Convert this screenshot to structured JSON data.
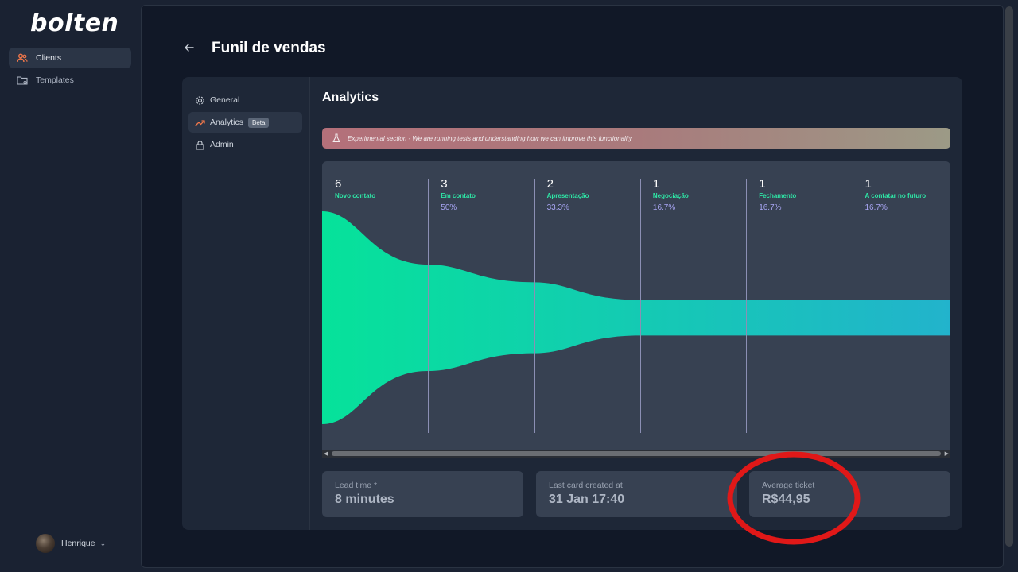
{
  "app": {
    "logo": "bolten"
  },
  "sidebar": {
    "items": [
      {
        "label": "Clients",
        "icon": "users-icon",
        "active": true
      },
      {
        "label": "Templates",
        "icon": "folder-settings-icon",
        "active": false
      }
    ]
  },
  "user": {
    "name": "Henrique"
  },
  "header": {
    "title": "Funil de vendas"
  },
  "settings_nav": {
    "items": [
      {
        "label": "General",
        "icon": "gear-icon"
      },
      {
        "label": "Analytics",
        "icon": "trending-up-icon",
        "badge": "Beta",
        "active": true
      },
      {
        "label": "Admin",
        "icon": "lock-icon"
      }
    ]
  },
  "section": {
    "title": "Analytics"
  },
  "banner": {
    "text": "Experimental section - We are running tests and understanding how we can improve this functionality",
    "icon": "flask-icon"
  },
  "funnel": {
    "stages": [
      {
        "count": "6",
        "name": "Novo contato",
        "pct": ""
      },
      {
        "count": "3",
        "name": "Em contato",
        "pct": "50%"
      },
      {
        "count": "2",
        "name": "Apresentação",
        "pct": "33.3%"
      },
      {
        "count": "1",
        "name": "Negociação",
        "pct": "16.7%"
      },
      {
        "count": "1",
        "name": "Fechamento",
        "pct": "16.7%"
      },
      {
        "count": "1",
        "name": "A contatar no futuro",
        "pct": "16.7%"
      }
    ],
    "values": [
      6,
      3,
      2,
      1,
      1,
      1
    ],
    "colors": {
      "start": "#06e29a",
      "end": "#22b3cc",
      "divider": "#8b8fb4"
    }
  },
  "stats": [
    {
      "label": "Lead time *",
      "value": "8 minutes"
    },
    {
      "label": "Last card created at",
      "value": "31 Jan 17:40"
    },
    {
      "label": "Average ticket",
      "value": "R$44,95"
    }
  ],
  "annotation": {
    "color": "#e01818"
  }
}
